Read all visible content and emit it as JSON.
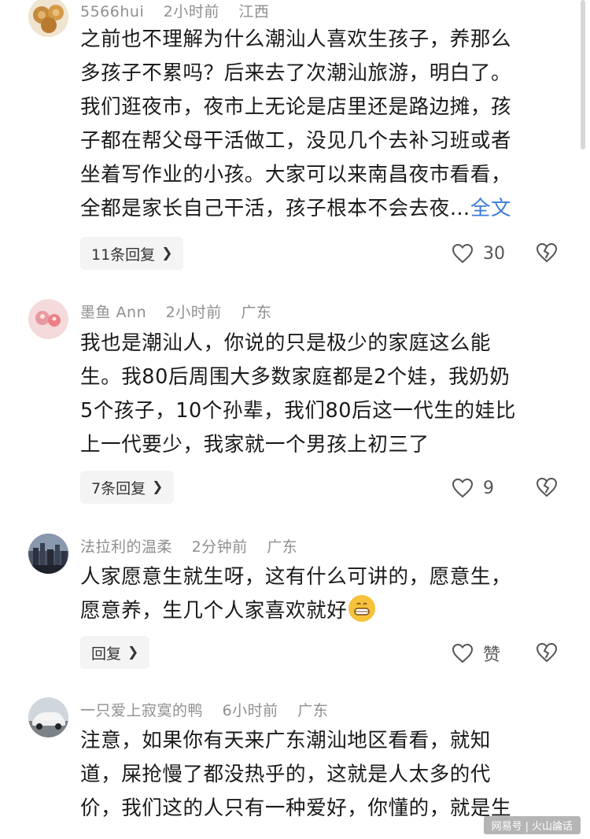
{
  "comments": [
    {
      "username": "5566hui",
      "time": "2小时前",
      "location": "江西",
      "lines": [
        "之前也不理解为什么潮汕人喜欢生孩子，养那么",
        "多孩子不累吗？后来去了次潮汕旅游，明白了。",
        "我们逛夜市，夜市上无论是店里还是路边摊，孩",
        "子都在帮父母干活做工，没见几个去补习班或者",
        "坐着写作业的小孩。大家可以来南昌夜市看看，",
        "全都是家长自己干活，孩子根本不会去夜…"
      ],
      "full_text_link": "全文",
      "reply_label": "11条回复",
      "like_count": "30"
    },
    {
      "username": "墨鱼 Ann",
      "time": "2小时前",
      "location": "广东",
      "lines": [
        "我也是潮汕人，你说的只是极少的家庭这么能",
        "生。我80后周围大多数家庭都是2个娃，我奶奶",
        "5个孩子，10个孙辈，我们80后这一代生的娃比",
        "上一代要少，我家就一个男孩上初三了"
      ],
      "reply_label": "7条回复",
      "like_count": "9"
    },
    {
      "username": "法拉利的温柔",
      "time": "2分钟前",
      "location": "广东",
      "lines": [
        "人家愿意生就生呀，这有什么可讲的，愿意生，",
        "愿意养，生几个人家喜欢就好"
      ],
      "reply_label": "回复",
      "like_count": "赞"
    },
    {
      "username": "一只爱上寂寞的鸭",
      "time": "6小时前",
      "location": "广东",
      "lines": [
        "注意，如果你有天来广东潮汕地区看看，就知",
        "道，屎抢慢了都没热乎的，这就是人太多的代",
        "价，我们这的人只有一种爱好，你懂的，就是生"
      ]
    }
  ],
  "watermark": {
    "left": "网易号",
    "right": "火山論话"
  },
  "colors": {
    "link": "#3b7bd8",
    "meta": "#8f8f8f",
    "text": "#1a1a1a"
  }
}
